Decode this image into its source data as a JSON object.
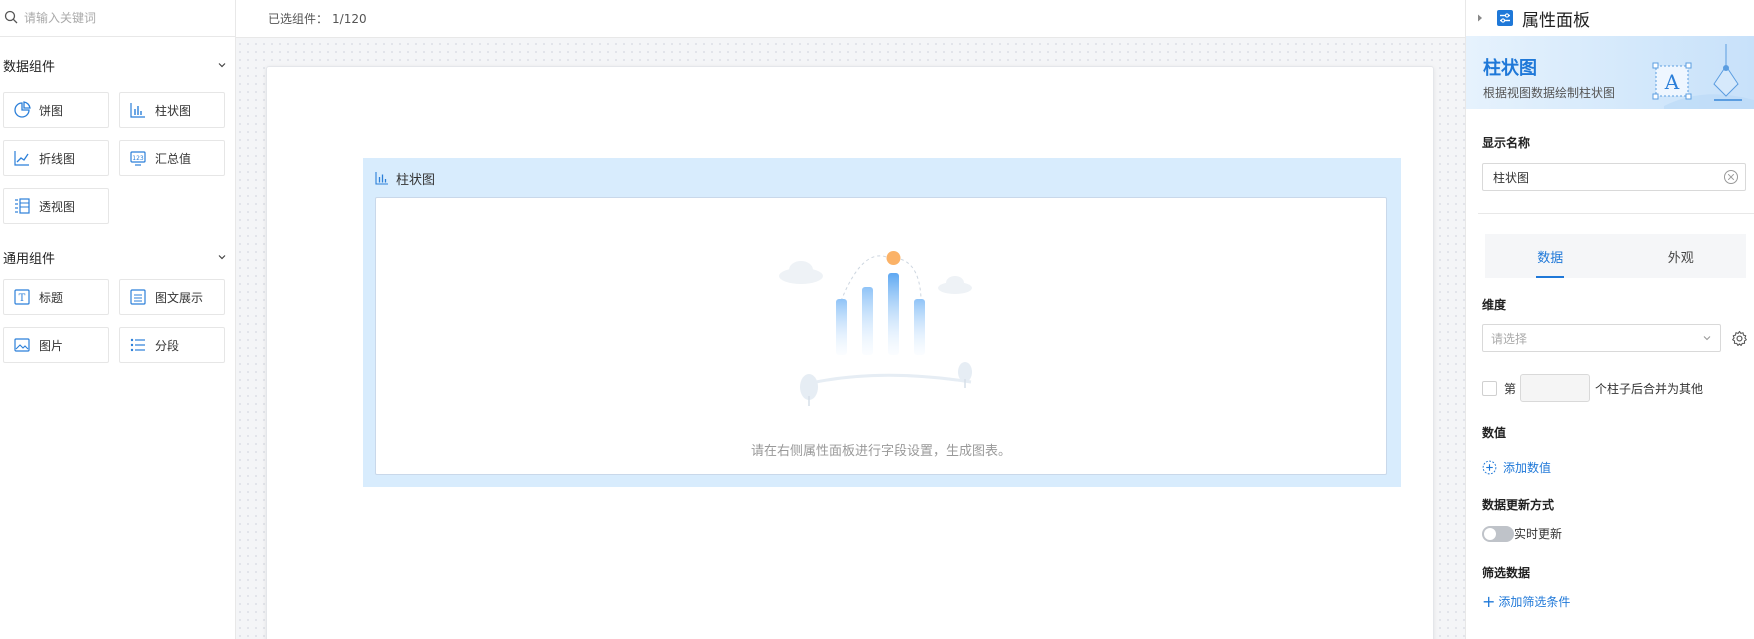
{
  "left": {
    "search_placeholder": "请输入关键词",
    "groups": [
      {
        "title": "数据组件",
        "items": [
          {
            "label": "饼图",
            "icon": "pie-chart-icon"
          },
          {
            "label": "柱状图",
            "icon": "bar-chart-icon"
          },
          {
            "label": "折线图",
            "icon": "line-chart-icon"
          },
          {
            "label": "汇总值",
            "icon": "summary-value-icon"
          },
          {
            "label": "透视图",
            "icon": "pivot-table-icon"
          }
        ]
      },
      {
        "title": "通用组件",
        "items": [
          {
            "label": "标题",
            "icon": "title-icon"
          },
          {
            "label": "图文展示",
            "icon": "rich-text-icon"
          },
          {
            "label": "图片",
            "icon": "image-icon"
          },
          {
            "label": "分段",
            "icon": "section-icon"
          }
        ]
      }
    ]
  },
  "toolbar": {
    "selected_label": "已选组件：",
    "selected_count": "1/120"
  },
  "widget": {
    "title": "柱状图",
    "empty_text": "请在右侧属性面板进行字段设置，生成图表。"
  },
  "panel": {
    "title": "属性面板",
    "banner_title": "柱状图",
    "banner_sub": "根据视图数据绘制柱状图",
    "display_name_label": "显示名称",
    "display_name_value": "柱状图",
    "tabs": [
      "数据",
      "外观"
    ],
    "active_tab": "数据",
    "dimension_label": "维度",
    "dimension_placeholder": "请选择",
    "merge_prefix": "第",
    "merge_suffix": "个柱子后合并为其他",
    "value_label": "数值",
    "add_value": "添加数值",
    "update_label": "数据更新方式",
    "realtime_label": "实时更新",
    "filter_label": "筛选数据",
    "add_filter": "添加筛选条件"
  },
  "colors": {
    "accent": "#1f78d8",
    "widget_bg": "#d8ecfd"
  }
}
